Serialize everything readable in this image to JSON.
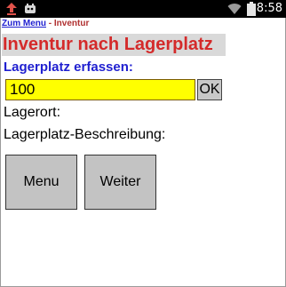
{
  "status_bar": {
    "time": "8:58",
    "icons": [
      "download-alert-icon",
      "app-notification-icon",
      "wifi-icon",
      "battery-icon"
    ]
  },
  "breadcrumb": {
    "link_label": "Zum Menu",
    "separator": "-",
    "current": "Inventur"
  },
  "page": {
    "title": "Inventur nach Lagerplatz"
  },
  "form": {
    "field_label": "Lagerplatz erfassen:",
    "input_value": "100",
    "ok_label": "OK",
    "lagerort_label": "Lagerort:",
    "beschreibung_label": "Lagerplatz-Beschreibung:"
  },
  "actions": {
    "menu_label": "Menu",
    "weiter_label": "Weiter"
  },
  "colors": {
    "title_text": "#d42a2a",
    "title_bg": "#d9d9d9",
    "label_blue": "#1f1fd0",
    "input_bg": "#ffff00",
    "button_bg": "#c3c3c3"
  }
}
